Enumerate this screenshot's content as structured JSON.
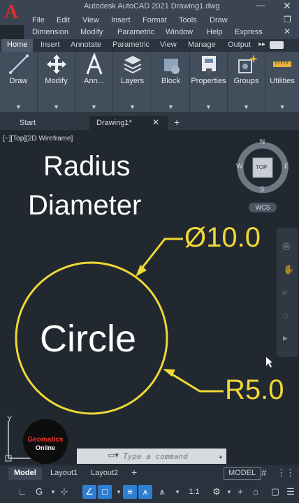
{
  "app": {
    "title": "Autodesk AutoCAD 2021    Drawing1.dwg",
    "logo_letter": "A"
  },
  "menu": [
    "File",
    "Edit",
    "View",
    "Insert",
    "Format",
    "Tools",
    "Draw",
    "Dimension",
    "Modify",
    "Parametric",
    "Window",
    "Help",
    "Express"
  ],
  "ribbon_tabs": [
    "Home",
    "Insert",
    "Annotate",
    "Parametric",
    "View",
    "Manage",
    "Output"
  ],
  "ribbon_panels": [
    {
      "label": "Draw",
      "icon": "line-icon"
    },
    {
      "label": "Modify",
      "icon": "move-icon"
    },
    {
      "label": "Ann...",
      "icon": "text-icon"
    },
    {
      "label": "Layers",
      "icon": "layers-icon"
    },
    {
      "label": "Block",
      "icon": "block-icon"
    },
    {
      "label": "Properties",
      "icon": "properties-icon"
    },
    {
      "label": "Groups",
      "icon": "groups-icon"
    },
    {
      "label": "Utilities",
      "icon": "measure-icon"
    }
  ],
  "file_tabs": {
    "start": "Start",
    "drawing": "Drawing1*"
  },
  "viewport": {
    "label": "[−][Top][2D Wireframe]"
  },
  "viewcube": {
    "n": "N",
    "s": "S",
    "e": "E",
    "w": "W",
    "face": "TOP",
    "wcs": "WCS"
  },
  "overlay_text": {
    "line1": "Radius",
    "line2": "Diameter"
  },
  "drawing": {
    "circle_label": "Circle",
    "diameter_text": "Ø10.0",
    "radius_text": "R5.0"
  },
  "ucs": {
    "axis_y": "Y"
  },
  "watermark": {
    "line1": "Geomatics",
    "line2": "Online"
  },
  "command_line": {
    "placeholder": "Type a command"
  },
  "layout_tabs": [
    "Model",
    "Layout1",
    "Layout2"
  ],
  "status": {
    "model_label": "MODEL",
    "scale": "1:1"
  },
  "colors": {
    "dimension": "#f0d836",
    "canvas": "#212830",
    "accent": "#2f7fd0"
  }
}
